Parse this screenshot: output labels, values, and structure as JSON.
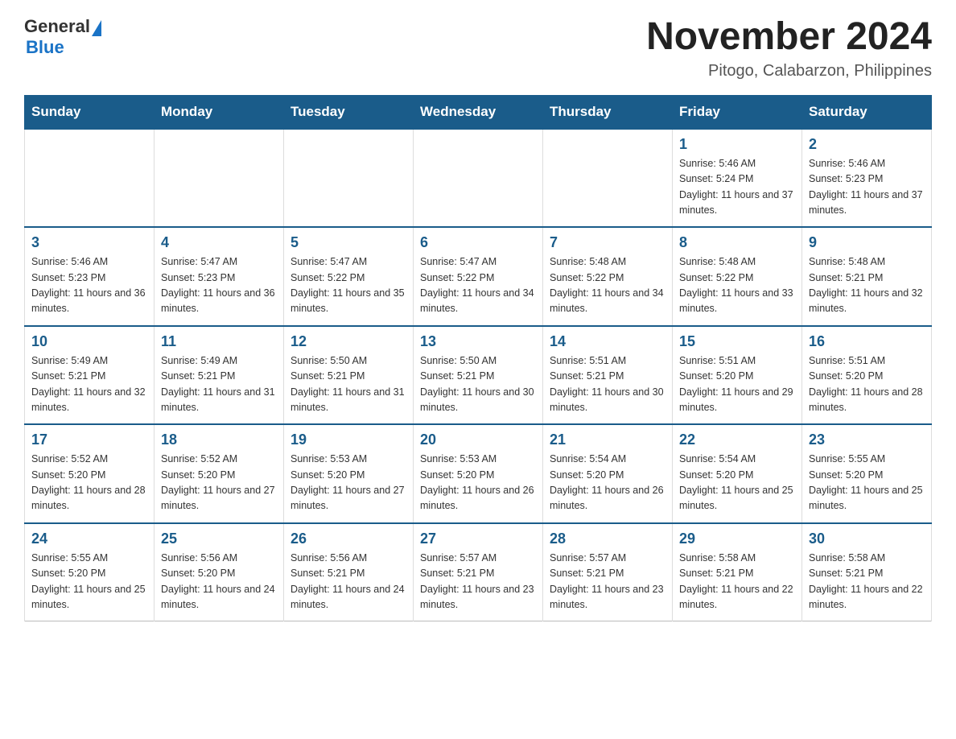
{
  "logo": {
    "general": "General",
    "blue": "Blue"
  },
  "title": {
    "month_year": "November 2024",
    "location": "Pitogo, Calabarzon, Philippines"
  },
  "days_header": [
    "Sunday",
    "Monday",
    "Tuesday",
    "Wednesday",
    "Thursday",
    "Friday",
    "Saturday"
  ],
  "weeks": [
    [
      {
        "day": "",
        "info": ""
      },
      {
        "day": "",
        "info": ""
      },
      {
        "day": "",
        "info": ""
      },
      {
        "day": "",
        "info": ""
      },
      {
        "day": "",
        "info": ""
      },
      {
        "day": "1",
        "info": "Sunrise: 5:46 AM\nSunset: 5:24 PM\nDaylight: 11 hours and 37 minutes."
      },
      {
        "day": "2",
        "info": "Sunrise: 5:46 AM\nSunset: 5:23 PM\nDaylight: 11 hours and 37 minutes."
      }
    ],
    [
      {
        "day": "3",
        "info": "Sunrise: 5:46 AM\nSunset: 5:23 PM\nDaylight: 11 hours and 36 minutes."
      },
      {
        "day": "4",
        "info": "Sunrise: 5:47 AM\nSunset: 5:23 PM\nDaylight: 11 hours and 36 minutes."
      },
      {
        "day": "5",
        "info": "Sunrise: 5:47 AM\nSunset: 5:22 PM\nDaylight: 11 hours and 35 minutes."
      },
      {
        "day": "6",
        "info": "Sunrise: 5:47 AM\nSunset: 5:22 PM\nDaylight: 11 hours and 34 minutes."
      },
      {
        "day": "7",
        "info": "Sunrise: 5:48 AM\nSunset: 5:22 PM\nDaylight: 11 hours and 34 minutes."
      },
      {
        "day": "8",
        "info": "Sunrise: 5:48 AM\nSunset: 5:22 PM\nDaylight: 11 hours and 33 minutes."
      },
      {
        "day": "9",
        "info": "Sunrise: 5:48 AM\nSunset: 5:21 PM\nDaylight: 11 hours and 32 minutes."
      }
    ],
    [
      {
        "day": "10",
        "info": "Sunrise: 5:49 AM\nSunset: 5:21 PM\nDaylight: 11 hours and 32 minutes."
      },
      {
        "day": "11",
        "info": "Sunrise: 5:49 AM\nSunset: 5:21 PM\nDaylight: 11 hours and 31 minutes."
      },
      {
        "day": "12",
        "info": "Sunrise: 5:50 AM\nSunset: 5:21 PM\nDaylight: 11 hours and 31 minutes."
      },
      {
        "day": "13",
        "info": "Sunrise: 5:50 AM\nSunset: 5:21 PM\nDaylight: 11 hours and 30 minutes."
      },
      {
        "day": "14",
        "info": "Sunrise: 5:51 AM\nSunset: 5:21 PM\nDaylight: 11 hours and 30 minutes."
      },
      {
        "day": "15",
        "info": "Sunrise: 5:51 AM\nSunset: 5:20 PM\nDaylight: 11 hours and 29 minutes."
      },
      {
        "day": "16",
        "info": "Sunrise: 5:51 AM\nSunset: 5:20 PM\nDaylight: 11 hours and 28 minutes."
      }
    ],
    [
      {
        "day": "17",
        "info": "Sunrise: 5:52 AM\nSunset: 5:20 PM\nDaylight: 11 hours and 28 minutes."
      },
      {
        "day": "18",
        "info": "Sunrise: 5:52 AM\nSunset: 5:20 PM\nDaylight: 11 hours and 27 minutes."
      },
      {
        "day": "19",
        "info": "Sunrise: 5:53 AM\nSunset: 5:20 PM\nDaylight: 11 hours and 27 minutes."
      },
      {
        "day": "20",
        "info": "Sunrise: 5:53 AM\nSunset: 5:20 PM\nDaylight: 11 hours and 26 minutes."
      },
      {
        "day": "21",
        "info": "Sunrise: 5:54 AM\nSunset: 5:20 PM\nDaylight: 11 hours and 26 minutes."
      },
      {
        "day": "22",
        "info": "Sunrise: 5:54 AM\nSunset: 5:20 PM\nDaylight: 11 hours and 25 minutes."
      },
      {
        "day": "23",
        "info": "Sunrise: 5:55 AM\nSunset: 5:20 PM\nDaylight: 11 hours and 25 minutes."
      }
    ],
    [
      {
        "day": "24",
        "info": "Sunrise: 5:55 AM\nSunset: 5:20 PM\nDaylight: 11 hours and 25 minutes."
      },
      {
        "day": "25",
        "info": "Sunrise: 5:56 AM\nSunset: 5:20 PM\nDaylight: 11 hours and 24 minutes."
      },
      {
        "day": "26",
        "info": "Sunrise: 5:56 AM\nSunset: 5:21 PM\nDaylight: 11 hours and 24 minutes."
      },
      {
        "day": "27",
        "info": "Sunrise: 5:57 AM\nSunset: 5:21 PM\nDaylight: 11 hours and 23 minutes."
      },
      {
        "day": "28",
        "info": "Sunrise: 5:57 AM\nSunset: 5:21 PM\nDaylight: 11 hours and 23 minutes."
      },
      {
        "day": "29",
        "info": "Sunrise: 5:58 AM\nSunset: 5:21 PM\nDaylight: 11 hours and 22 minutes."
      },
      {
        "day": "30",
        "info": "Sunrise: 5:58 AM\nSunset: 5:21 PM\nDaylight: 11 hours and 22 minutes."
      }
    ]
  ]
}
